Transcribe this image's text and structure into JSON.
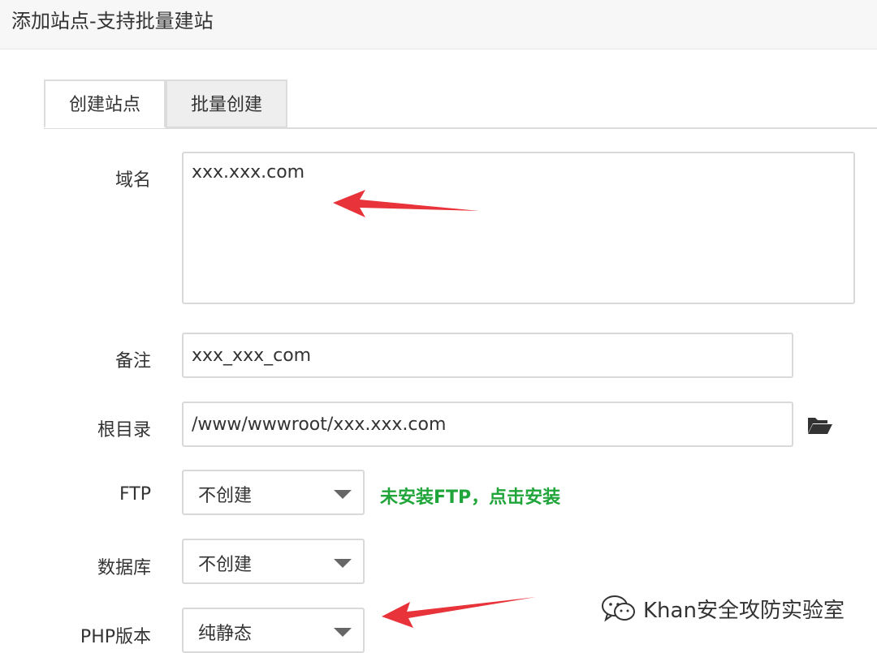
{
  "window": {
    "title": "添加站点-支持批量建站"
  },
  "tabs": [
    {
      "label": "创建站点"
    },
    {
      "label": "批量创建"
    }
  ],
  "form": {
    "domain": {
      "label": "域名",
      "value": "xxx.xxx.com"
    },
    "remark": {
      "label": "备注",
      "value": "xxx_xxx_com"
    },
    "root": {
      "label": "根目录",
      "value": "/www/wwwroot/xxx.xxx.com",
      "icon": "folder-open-icon"
    },
    "ftp": {
      "label": "FTP",
      "selected": "不创建",
      "hint": "未安装FTP，点击安装"
    },
    "database": {
      "label": "数据库",
      "selected": "不创建"
    },
    "php": {
      "label": "PHP版本",
      "selected": "纯静态"
    }
  },
  "watermark": {
    "text": "Khan安全攻防实验室",
    "icon": "wechat-icon"
  },
  "colors": {
    "accent_green": "#20a53a",
    "arrow_red": "#e8333a"
  }
}
